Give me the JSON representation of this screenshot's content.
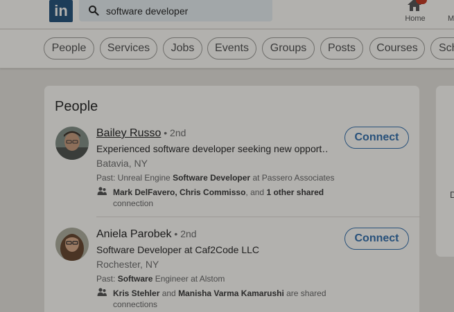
{
  "header": {
    "logo_text": "in",
    "search_value": "software developer",
    "nav": [
      {
        "label": "Home"
      },
      {
        "label": "M"
      }
    ]
  },
  "filters": [
    "People",
    "Services",
    "Jobs",
    "Events",
    "Groups",
    "Posts",
    "Courses",
    "Sch"
  ],
  "people_section": {
    "title": "People",
    "results": [
      {
        "name": "Bailey Russo",
        "degree": " • 2nd",
        "headline": "Experienced software developer seeking new opport…",
        "location": "Batavia, NY",
        "past_prefix": "Past: Unreal Engine ",
        "past_bold": "Software Developer",
        "past_suffix": " at Passero Associates",
        "shared_names": "Mark DelFavero, Chris Commisso",
        "shared_mid": ", and ",
        "shared_count": "1 other shared",
        "shared_end": "connection",
        "connect_label": "Connect"
      },
      {
        "name": "Aniela Parobek",
        "degree": " • 2nd",
        "headline": "Software Developer at Caf2Code LLC",
        "location": "Rochester, NY",
        "past_prefix": "Past: ",
        "past_bold": "Software",
        "past_suffix": " Engineer at Alstom",
        "shared_names": "Kris Stehler",
        "shared_mid": " and ",
        "shared_count": "Manisha Varma Kamarushi",
        "shared_end": " are shared connections",
        "connect_label": "Connect"
      }
    ]
  },
  "side_panel": {
    "letter": "D"
  },
  "colors": {
    "accent": "#27507a",
    "logo": "#1d3d59",
    "badge": "#8a2b1c"
  }
}
